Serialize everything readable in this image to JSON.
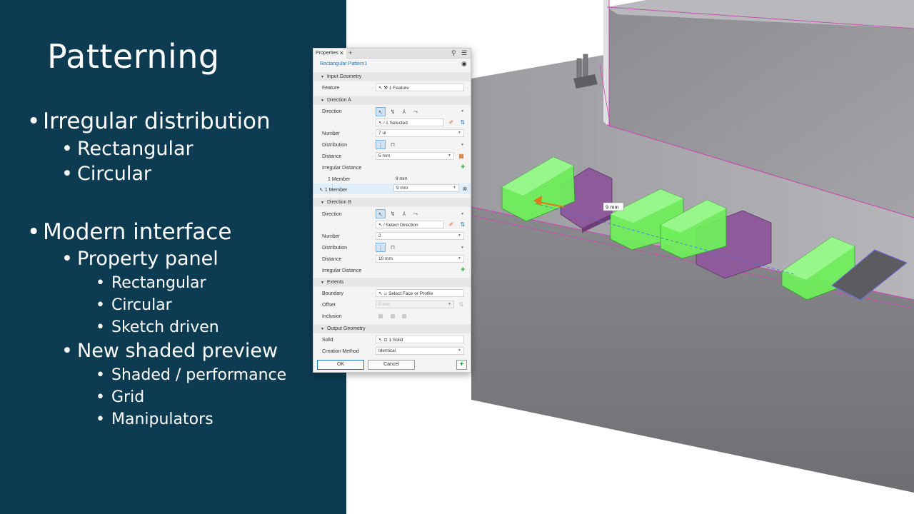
{
  "slide": {
    "title": "Patterning",
    "bullets": [
      {
        "level": 1,
        "text": "Irregular distribution"
      },
      {
        "level": 2,
        "text": "Rectangular"
      },
      {
        "level": 2,
        "text": "Circular"
      },
      {
        "level": 1,
        "text": "Modern interface"
      },
      {
        "level": 2,
        "text": "Property panel"
      },
      {
        "level": 3,
        "text": "Rectangular"
      },
      {
        "level": 3,
        "text": "Circular"
      },
      {
        "level": 3,
        "text": "Sketch driven"
      },
      {
        "level": 2,
        "text": "New shaded preview"
      },
      {
        "level": 3,
        "text": "Shaded / performance"
      },
      {
        "level": 3,
        "text": "Grid"
      },
      {
        "level": 3,
        "text": "Manipulators"
      }
    ],
    "background_color": "#0d3b52"
  },
  "properties_panel": {
    "tab_label": "Properties",
    "feature_name": "Rectangular Pattern1",
    "sections": {
      "input_geometry": "Input Geometry",
      "direction_a": "Direction A",
      "direction_b": "Direction B",
      "extents": "Extents",
      "output_geometry": "Output Geometry"
    },
    "input_geometry": {
      "feature_label": "Feature",
      "feature_value": "1 Feature"
    },
    "direction_a": {
      "direction_label": "Direction",
      "selection_value": "1 Selected",
      "number_label": "Number",
      "number_value": "7 ul",
      "distribution_label": "Distribution",
      "distance_label": "Distance",
      "distance_value": "5 mm",
      "irregular_label": "Irregular Distance",
      "member1_label": "1 Member",
      "member1_value": "9 mm",
      "member2_label": "1 Member",
      "member2_value": "9 mm"
    },
    "direction_b": {
      "direction_label": "Direction",
      "selection_value": "Select Direction",
      "number_label": "Number",
      "number_value": "2",
      "distribution_label": "Distribution",
      "distance_label": "Distance",
      "distance_value": "10 mm",
      "irregular_label": "Irregular Distance"
    },
    "extents": {
      "boundary_label": "Boundary",
      "boundary_value": "Select Face or Profile",
      "offset_label": "Offset",
      "offset_value": "0 mm",
      "inclusion_label": "Inclusion"
    },
    "output_geometry": {
      "solid_label": "Solid",
      "solid_value": "1 Solid",
      "method_label": "Creation Method",
      "method_value": "Identical"
    },
    "ok_label": "OK",
    "cancel_label": "Cancel"
  },
  "viewport": {
    "dimension_label": "9 mm",
    "colors": {
      "preview_green": "#6ef15a",
      "preview_purple": "#8f5a9a",
      "edge_magenta": "#c44fb0",
      "body_gray": "#7e7e80"
    }
  }
}
